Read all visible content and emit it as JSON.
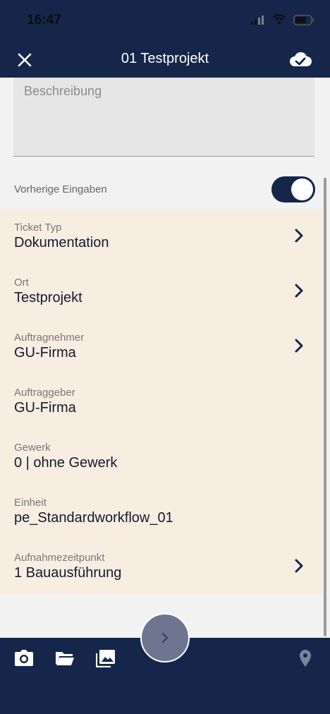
{
  "status_bar": {
    "time": "16:47"
  },
  "nav": {
    "title": "01 Testprojekt"
  },
  "description": {
    "placeholder": "Beschreibung"
  },
  "toggle": {
    "label": "Vorherige Eingaben",
    "on": true
  },
  "fields": [
    {
      "label": "Ticket Typ",
      "value": "Dokumentation",
      "has_chevron": true
    },
    {
      "label": "Ort",
      "value": "Testprojekt",
      "has_chevron": true
    },
    {
      "label": "Auftragnehmer",
      "value": "GU-Firma",
      "has_chevron": true
    },
    {
      "label": "Auftraggeber",
      "value": "GU-Firma",
      "has_chevron": false
    },
    {
      "label": "Gewerk",
      "value": "0 | ohne Gewerk",
      "has_chevron": false
    },
    {
      "label": "Einheit",
      "value": "pe_Standardworkflow_01",
      "has_chevron": false
    },
    {
      "label": "Aufnahmezeitpunkt",
      "value": "1 Bauausführung",
      "has_chevron": true
    }
  ],
  "bottom_bar": {
    "icons": [
      "camera-icon",
      "folder-icon",
      "gallery-icon",
      "location-pin-icon"
    ],
    "fab_icon": "chevron-right-icon"
  },
  "colors": {
    "navy": "#15264a",
    "list_bg": "#f7eee1",
    "fab": "#6d7591"
  }
}
